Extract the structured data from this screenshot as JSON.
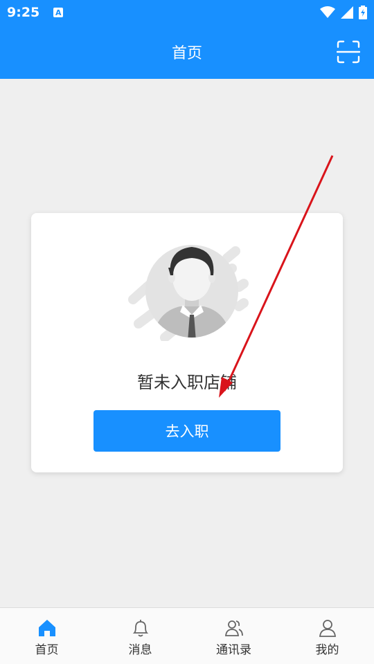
{
  "status_bar": {
    "time": "9:25",
    "notification_icon_letter": "A"
  },
  "header": {
    "title": "首页",
    "scan_icon": "scan-icon"
  },
  "card": {
    "empty_text": "暂未入职店铺",
    "button_label": "去入职"
  },
  "tabbar": {
    "items": [
      {
        "label": "首页",
        "icon": "home-icon",
        "active": true
      },
      {
        "label": "消息",
        "icon": "bell-icon",
        "active": false
      },
      {
        "label": "通讯录",
        "icon": "contacts-icon",
        "active": false
      },
      {
        "label": "我的",
        "icon": "user-icon",
        "active": false
      }
    ]
  },
  "colors": {
    "primary": "#1890ff",
    "background": "#efefef",
    "annotation_arrow": "#d9141b"
  }
}
